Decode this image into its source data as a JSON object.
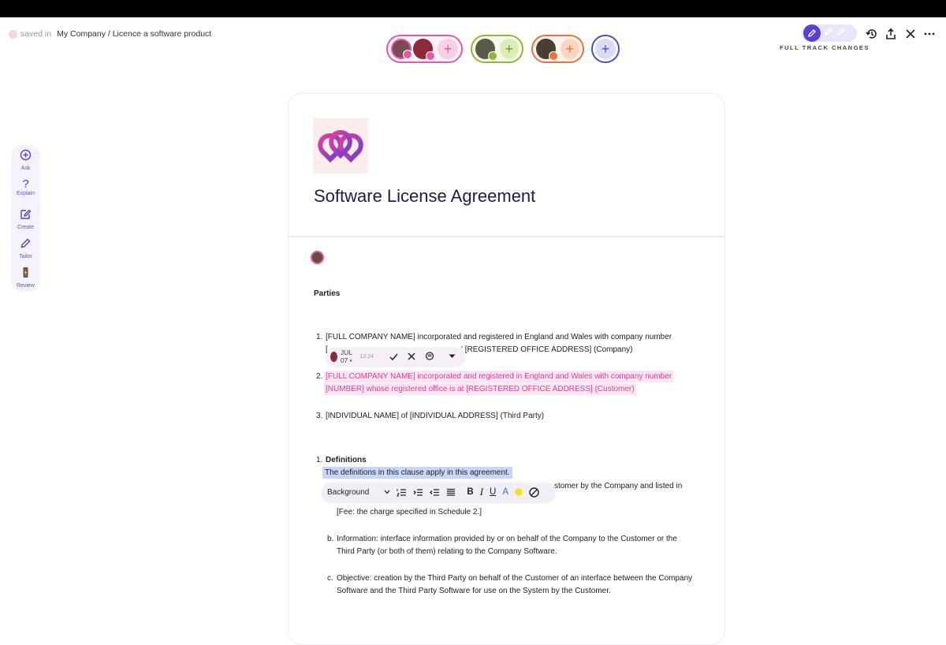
{
  "header": {
    "saved_label": "saved in",
    "breadcrumb": "My Company / Licence a software product",
    "track_changes_label": "FULL TRACK CHANGES"
  },
  "collaborators": [
    {
      "group": "pink",
      "color": "#e15ba7",
      "plus": "+"
    },
    {
      "group": "green",
      "color": "#8db83a",
      "plus": "+"
    },
    {
      "group": "orange",
      "color": "#e8743a",
      "plus": "+"
    },
    {
      "group": "add",
      "color": "#4a4fc8",
      "plus": "+"
    }
  ],
  "sidebar": {
    "items": [
      {
        "label": "Ask",
        "icon": "ask-icon"
      },
      {
        "label": "Explain",
        "icon": "question-icon"
      },
      {
        "label": "Create",
        "icon": "create-icon"
      },
      {
        "label": "Tailor",
        "icon": "pen-icon"
      },
      {
        "label": "Review",
        "icon": "traffic-light-icon"
      }
    ]
  },
  "document": {
    "title": "Software License Agreement",
    "parties_heading": "Parties",
    "p1_num": "1.",
    "p1_line1": "[FULL COMPANY NAME] incorporated and registered in England and Wales with company number",
    "p1_line2_start": "[",
    "p1_line2_end": "' [REGISTERED OFFICE ADDRESS] (Company)",
    "p2_num": "2.",
    "p2_line1": "[FULL COMPANY NAME] incorporated and registered in England and Wales with company number",
    "p2_line2": "[NUMBER] whose registered office is at [REGISTERED OFFICE ADDRESS] (Customer)",
    "p3_num": "3.",
    "p3_text": "[INDIVIDUAL NAME] of [INDIVIDUAL ADDRESS] (Third Party)",
    "def_num": "1.",
    "def_heading": "Definitions",
    "def_selected": "The definitions in this clause apply in this agreement.",
    "def_a_tail": "stomer by the Company and listed in",
    "def_a_line2": "[Fee: the charge specified in Schedule 2.]",
    "def_b_marker": "b.",
    "def_b_line1": "Information: interface information provided by or on behalf of the Company to the Customer or the",
    "def_b_line2": "Third Party (or both of them) relating to the Company Software.",
    "def_c_marker": "c.",
    "def_c_line1": "Objective: creation by the Third Party on behalf of the Customer of an interface between the Company",
    "def_c_line2": "Software and the Third Party Software for use on the System by the Customer."
  },
  "change_popup": {
    "date": "JUL 07 •",
    "time": "12:24"
  },
  "format_bar": {
    "style_select": "Background",
    "bold": "B",
    "italic": "I",
    "underline": "U",
    "text_color": "A"
  },
  "colors": {
    "accent": "#5b3fd0",
    "insertion": "#e0409c",
    "selection": "#c9d6f7"
  }
}
